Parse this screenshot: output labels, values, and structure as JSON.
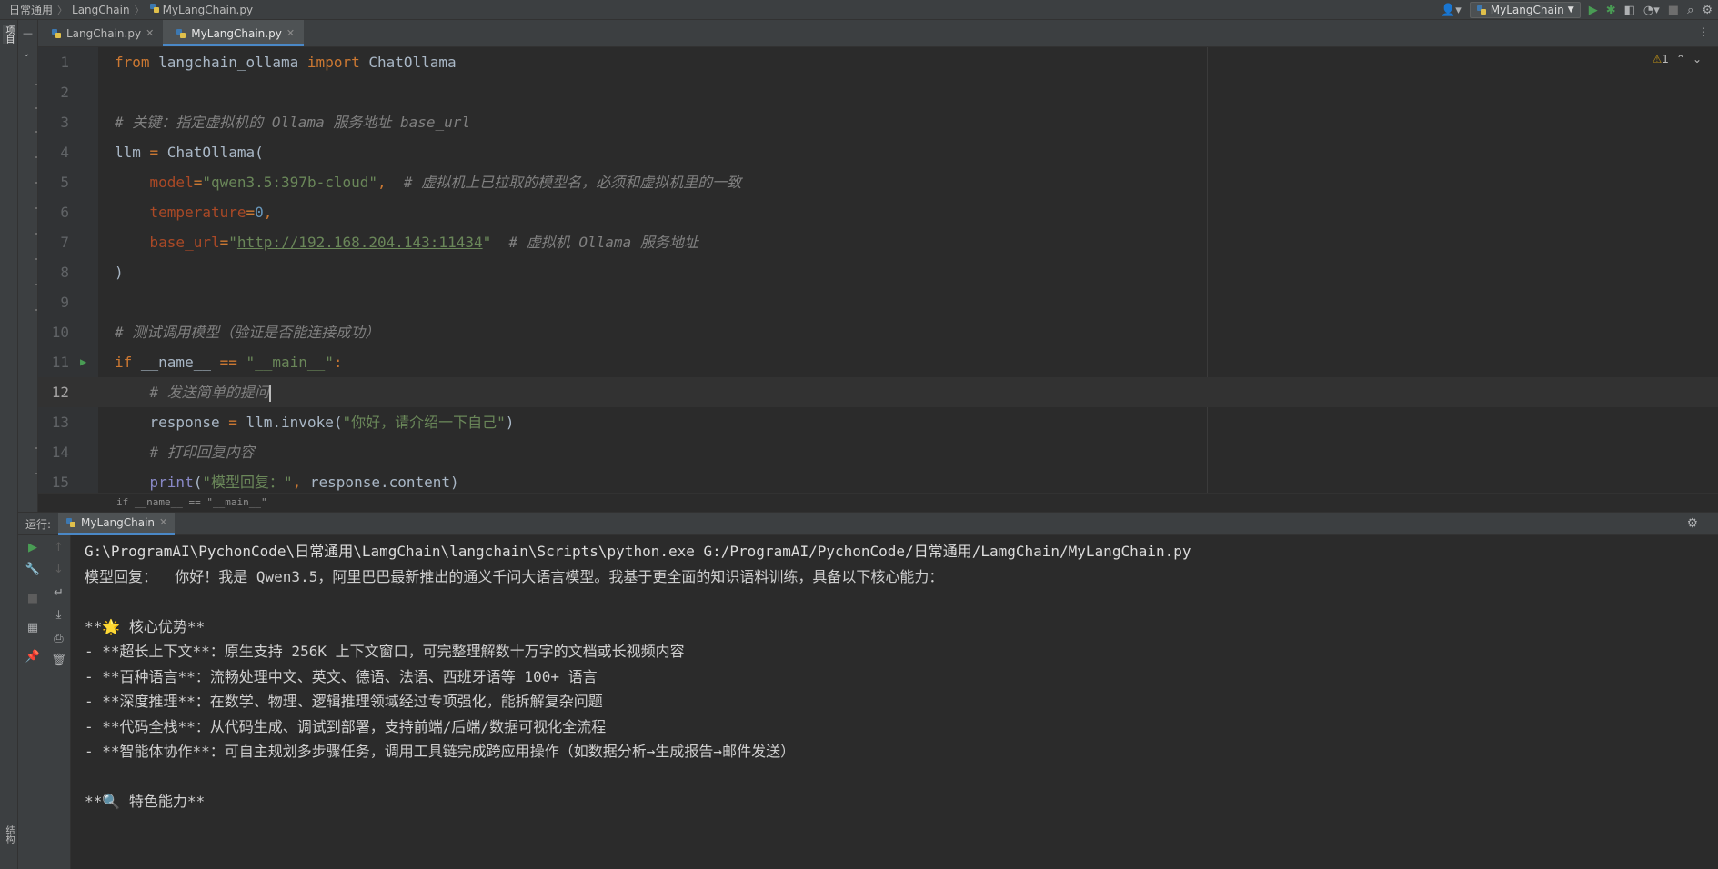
{
  "breadcrumbs": [
    "日常通用",
    "LangChain",
    "MyLangChain.py"
  ],
  "toolbar": {
    "run_config": "MyLangChain",
    "icons": [
      "user-icon",
      "run-icon",
      "debug-icon",
      "coverage-icon",
      "profile-icon",
      "stop-icon",
      "search-icon",
      "settings-icon"
    ]
  },
  "left_strip": {
    "project_label": "项目",
    "structure_label": "结构"
  },
  "editor_tabs": [
    {
      "label": "LangChain.py",
      "active": false
    },
    {
      "label": "MyLangChain.py",
      "active": true
    }
  ],
  "editor": {
    "warnings_count": "1",
    "breadcrumb": "if __name__ == \"__main__\"",
    "current_line": 12,
    "lines": [
      {
        "n": "1",
        "tokens": [
          [
            "kw",
            "from"
          ],
          [
            "fn",
            " langchain_ollama "
          ],
          [
            "kw",
            "import"
          ],
          [
            "fn",
            " ChatOllama"
          ]
        ]
      },
      {
        "n": "2",
        "tokens": []
      },
      {
        "n": "3",
        "tokens": [
          [
            "cm",
            "# 关键：指定虚拟机的 Ollama 服务地址 base_url"
          ]
        ]
      },
      {
        "n": "4",
        "tokens": [
          [
            "fn",
            "llm "
          ],
          [
            "kw",
            "="
          ],
          [
            "fn",
            " ChatOllama("
          ]
        ]
      },
      {
        "n": "5",
        "tokens": [
          [
            "fn",
            "    "
          ],
          [
            "param",
            "model"
          ],
          [
            "kw",
            "="
          ],
          [
            "str",
            "\"qwen3.5:397b-cloud\""
          ],
          [
            "kw",
            ","
          ],
          [
            "fn",
            "  "
          ],
          [
            "cm",
            "# 虚拟机上已拉取的模型名，必须和虚拟机里的一致"
          ]
        ]
      },
      {
        "n": "6",
        "tokens": [
          [
            "fn",
            "    "
          ],
          [
            "param",
            "temperature"
          ],
          [
            "kw",
            "="
          ],
          [
            "num",
            "0"
          ],
          [
            "kw",
            ","
          ]
        ]
      },
      {
        "n": "7",
        "tokens": [
          [
            "fn",
            "    "
          ],
          [
            "param",
            "base_url"
          ],
          [
            "kw",
            "="
          ],
          [
            "str",
            "\""
          ],
          [
            "url",
            "http://192.168.204.143:11434"
          ],
          [
            "str",
            "\""
          ],
          [
            "fn",
            "  "
          ],
          [
            "cm",
            "# 虚拟机 Ollama 服务地址"
          ]
        ]
      },
      {
        "n": "8",
        "tokens": [
          [
            "fn",
            ")"
          ]
        ]
      },
      {
        "n": "9",
        "tokens": []
      },
      {
        "n": "10",
        "tokens": [
          [
            "cm",
            "# 测试调用模型（验证是否能连接成功）"
          ]
        ]
      },
      {
        "n": "11",
        "tokens": [
          [
            "kw",
            "if"
          ],
          [
            "fn",
            " __name__ "
          ],
          [
            "kw",
            "=="
          ],
          [
            "fn",
            " "
          ],
          [
            "str",
            "\"__main__\""
          ],
          [
            "kw",
            ":"
          ]
        ]
      },
      {
        "n": "12",
        "tokens": [
          [
            "fn",
            "    "
          ],
          [
            "cm",
            "# 发送简单的提问"
          ]
        ]
      },
      {
        "n": "13",
        "tokens": [
          [
            "fn",
            "    response "
          ],
          [
            "kw",
            "="
          ],
          [
            "fn",
            " llm.invoke("
          ],
          [
            "str",
            "\"你好，请介绍一下自己\""
          ],
          [
            "fn",
            ")"
          ]
        ]
      },
      {
        "n": "14",
        "tokens": [
          [
            "fn",
            "    "
          ],
          [
            "cm",
            "# 打印回复内容"
          ]
        ]
      },
      {
        "n": "15",
        "tokens": [
          [
            "fn",
            "    "
          ],
          [
            "builtin",
            "print"
          ],
          [
            "fn",
            "("
          ],
          [
            "str",
            "\"模型回复：\""
          ],
          [
            "kw",
            ","
          ],
          [
            "fn",
            " response.content)"
          ]
        ]
      }
    ]
  },
  "run_panel": {
    "label": "运行:",
    "tab": "MyLangChain",
    "output": [
      "G:\\ProgramAI\\PychonCode\\日常通用\\LamgChain\\langchain\\Scripts\\python.exe G:/ProgramAI/PychonCode/日常通用/LamgChain/MyLangChain.py",
      "模型回复：  你好！我是 Qwen3.5，阿里巴巴最新推出的通义千问大语言模型。我基于更全面的知识语料训练，具备以下核心能力：",
      "",
      "**🌟 核心优势**",
      "- **超长上下文**：原生支持 256K 上下文窗口，可完整理解数十万字的文档或长视频内容",
      "- **百种语言**：流畅处理中文、英文、德语、法语、西班牙语等 100+ 语言",
      "- **深度推理**：在数学、物理、逻辑推理领域经过专项强化，能拆解复杂问题",
      "- **代码全栈**：从代码生成、调试到部署，支持前端/后端/数据可视化全流程",
      "- **智能体协作**：可自主规划多步骤任务，调用工具链完成跨应用操作（如数据分析→生成报告→邮件发送）",
      "",
      "**🔍 特色能力**"
    ]
  }
}
